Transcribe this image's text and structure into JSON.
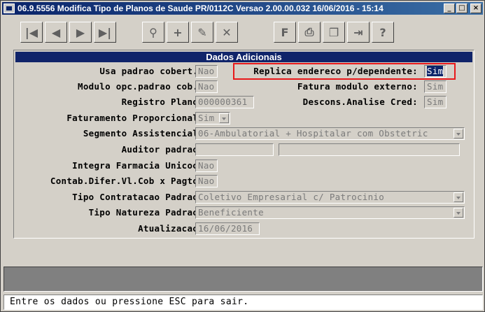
{
  "window": {
    "title": "06.9.5556  Modifica  Tipo de Planos de Saude PR/0112C Versao 2.00.00.032 16/06/2016 - 15:14",
    "controls": {
      "minimize": "_",
      "maximize": "□",
      "close": "×"
    }
  },
  "toolbar": {
    "buttons": [
      {
        "name": "first-record-icon",
        "glyph": "|◀"
      },
      {
        "name": "previous-record-icon",
        "glyph": "◀"
      },
      {
        "name": "next-record-icon",
        "glyph": "▶"
      },
      {
        "name": "last-record-icon",
        "glyph": "▶|"
      },
      {
        "name": "search-icon",
        "glyph": "⚲"
      },
      {
        "name": "add-record-icon",
        "glyph": "+"
      },
      {
        "name": "edit-record-icon",
        "glyph": "✎"
      },
      {
        "name": "delete-record-icon",
        "glyph": "✕"
      },
      {
        "name": "filter-icon",
        "glyph": "F"
      },
      {
        "name": "print-icon",
        "glyph": "⎙"
      },
      {
        "name": "copy-icon",
        "glyph": "❐"
      },
      {
        "name": "exit-icon",
        "glyph": "⇥"
      },
      {
        "name": "help-icon",
        "glyph": "?"
      }
    ]
  },
  "panel": {
    "title": "Dados Adicionais",
    "fields": {
      "usa_padrao_cobert": {
        "label": "Usa padrao cobert.:",
        "value": "Nao"
      },
      "replica_endereco": {
        "label": "Replica endereco p/dependente:",
        "value": "Sim"
      },
      "modulo_opc_padrao": {
        "label": "Modulo opc.padrao cob.:",
        "value": "Nao"
      },
      "fatura_modulo_externo": {
        "label": "Fatura modulo externo:",
        "value": "Sim"
      },
      "registro_plano": {
        "label": "Registro Plano:",
        "value": "000000361"
      },
      "descons_analise_cred": {
        "label": "Descons.Analise Cred:",
        "value": "Sim"
      },
      "faturamento_proporcional": {
        "label": "Faturamento Proporcional:",
        "value": "Sim"
      },
      "segmento_assistencial": {
        "label": "Segmento Assistencial:",
        "value": "06-Ambulatorial + Hospitalar com Obstetric"
      },
      "auditor_padrao": {
        "label": "Auditor padrao:",
        "value": "",
        "value2": ""
      },
      "integra_farmacia_unicoo": {
        "label": "Integra Farmacia Unicoo:",
        "value": "Nao"
      },
      "contab_difer": {
        "label": "Contab.Difer.Vl.Cob x Pagto:",
        "value": "Nao"
      },
      "tipo_contratacao_padrao": {
        "label": "Tipo Contratacao Padrao:",
        "value": "Coletivo Empresarial c/ Patrocinio"
      },
      "tipo_natureza_padrao": {
        "label": "Tipo Natureza Padrao:",
        "value": "Beneficiente"
      },
      "atualizacao": {
        "label": "Atualizacao:",
        "value": "16/06/2016"
      }
    }
  },
  "status_bar": {
    "message": "Entre os dados ou pressione ESC para sair."
  },
  "colors": {
    "title_bar": "#0a246a",
    "panel_header": "#10246a",
    "highlight": "#e8191b",
    "window_bg": "#d4d0c8"
  }
}
